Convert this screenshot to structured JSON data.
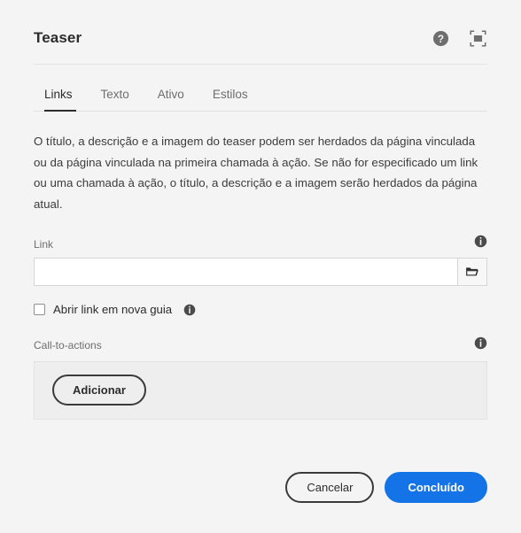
{
  "header": {
    "title": "Teaser",
    "help_icon": "help-circle-icon",
    "fullscreen_icon": "fullscreen-icon"
  },
  "tabs": [
    {
      "label": "Links",
      "active": true
    },
    {
      "label": "Texto",
      "active": false
    },
    {
      "label": "Ativo",
      "active": false
    },
    {
      "label": "Estilos",
      "active": false
    }
  ],
  "main": {
    "description": "O título, a descrição e a imagem do teaser podem ser herdados da página vinculada ou da página vinculada na primeira chamada à ação. Se não for especificado um link ou uma chamada à ação, o título, a descrição e a imagem serão herdados da página atual.",
    "link_field": {
      "label": "Link",
      "value": "",
      "placeholder": "",
      "browse_icon": "folder-icon",
      "info_icon": "info-circle-icon"
    },
    "new_tab_checkbox": {
      "label": "Abrir link em nova guia",
      "checked": false,
      "info_icon": "info-circle-icon"
    },
    "call_to_actions": {
      "label": "Call-to-actions",
      "add_label": "Adicionar",
      "info_icon": "info-circle-icon"
    }
  },
  "footer": {
    "cancel_label": "Cancelar",
    "confirm_label": "Concluído"
  },
  "colors": {
    "accent": "#1473e6",
    "background": "#f4f4f4",
    "text": "#2c2c2c",
    "muted_text": "#6e6e6e",
    "panel": "#eeeeee"
  }
}
